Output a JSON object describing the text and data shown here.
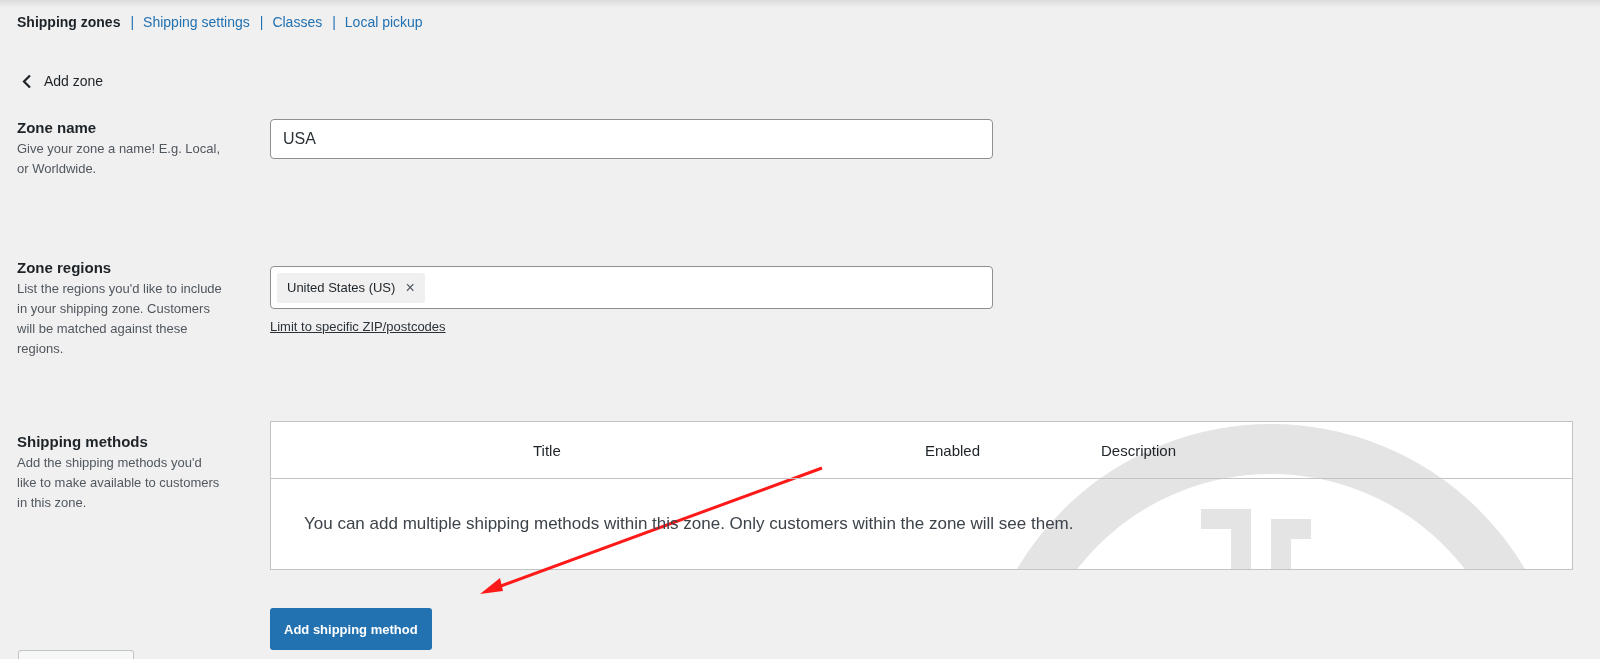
{
  "tabs": [
    {
      "label": "Shipping zones",
      "selected": true
    },
    {
      "label": "Shipping settings",
      "selected": false
    },
    {
      "label": "Classes",
      "selected": false
    },
    {
      "label": "Local pickup",
      "selected": false
    }
  ],
  "tab_separator": "|",
  "back": {
    "label": "Add zone"
  },
  "zone_name": {
    "title": "Zone name",
    "description": "Give your zone a name! E.g. Local, or Worldwide.",
    "value": "USA"
  },
  "zone_regions": {
    "title": "Zone regions",
    "description": "List the regions you'd like to include in your shipping zone. Customers will be matched against these regions.",
    "tags": [
      "United States (US)"
    ],
    "remove_symbol": "×",
    "link": "Limit to specific ZIP/postcodes"
  },
  "shipping_methods": {
    "title": "Shipping methods",
    "description": "Add the shipping methods you'd like to make available to customers in this zone.",
    "columns": [
      "Title",
      "Enabled",
      "Description"
    ],
    "empty_message": "You can add multiple shipping methods within this zone. Only customers within the zone will see them.",
    "button": "Add shipping method"
  }
}
